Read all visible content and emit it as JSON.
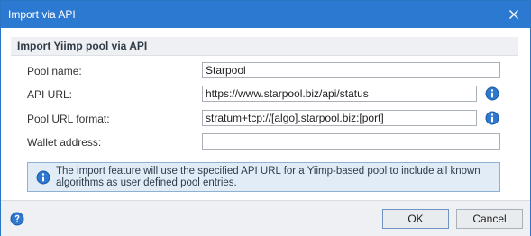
{
  "window": {
    "title": "Import via API"
  },
  "section": {
    "title": "Import Yiimp pool via API"
  },
  "fields": {
    "pool_name": {
      "label": "Pool name:",
      "value": "Starpool"
    },
    "api_url": {
      "label": "API URL:",
      "value": "https://www.starpool.biz/api/status"
    },
    "pool_url_format": {
      "label": "Pool URL format:",
      "value": "stratum+tcp://[algo].starpool.biz:[port]"
    },
    "wallet_address": {
      "label": "Wallet address:",
      "value": ""
    }
  },
  "info": {
    "text": "The import feature will use the specified API URL for a Yiimp-based pool to include all known algorithms as user defined pool entries."
  },
  "buttons": {
    "ok": "OK",
    "cancel": "Cancel"
  },
  "icons": {
    "close": "close-icon",
    "info": "info-icon",
    "help": "help-icon"
  },
  "colors": {
    "titlebar": "#2b79d0",
    "section_header": "#eef0f3",
    "infobox_bg": "#e2ecf6",
    "info_icon": "#1f5fb0"
  }
}
